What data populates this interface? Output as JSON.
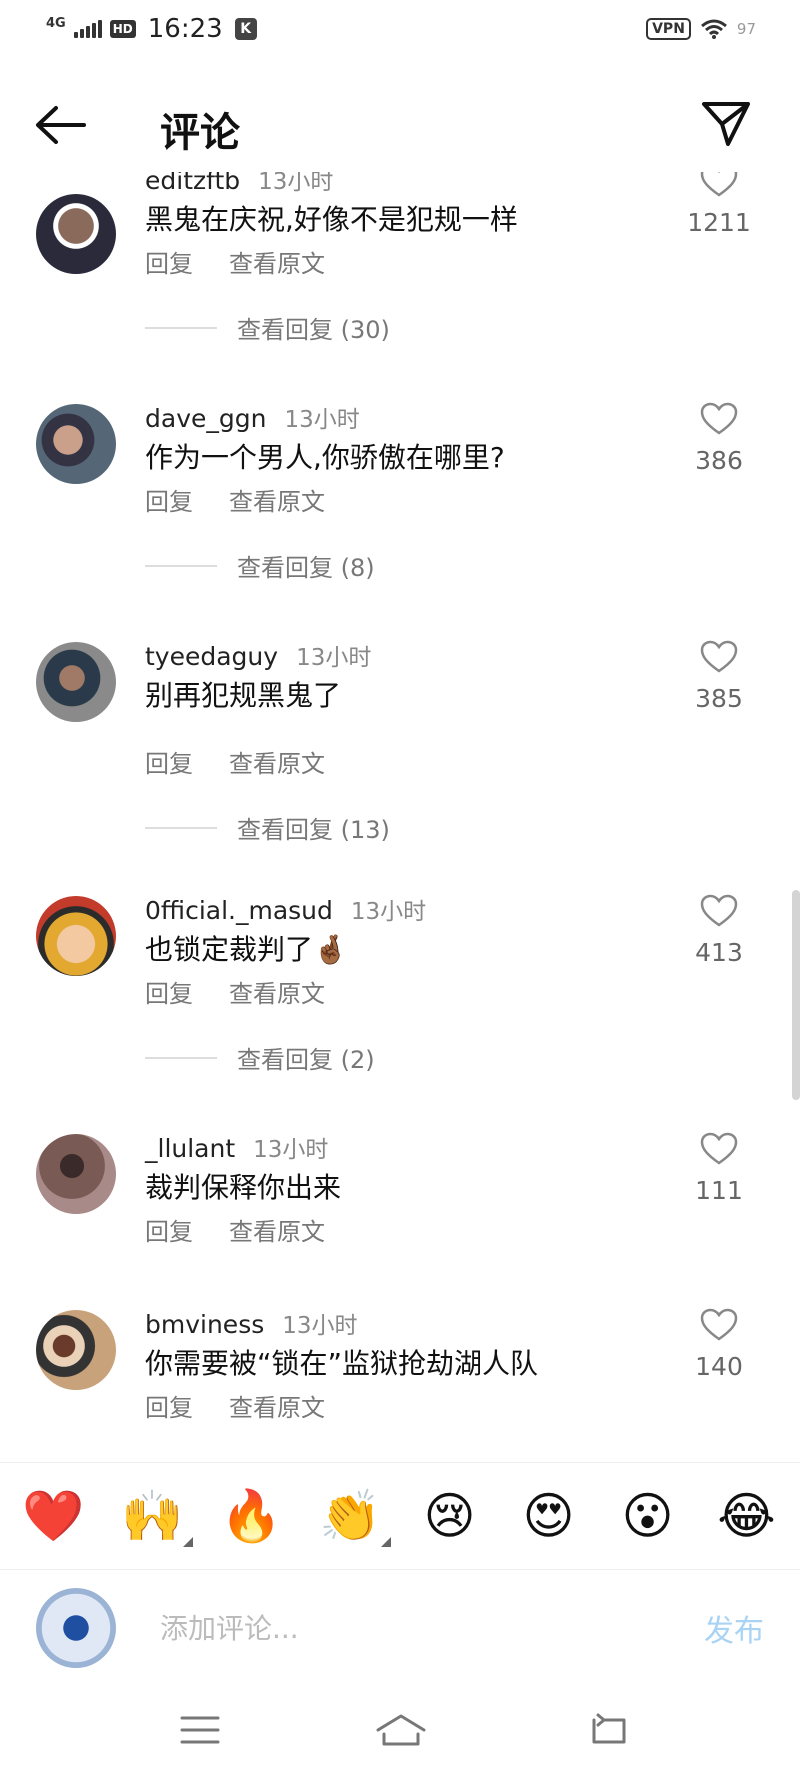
{
  "status_bar": {
    "network": "4G",
    "hd": "HD",
    "time": "16:23",
    "k_badge": "K",
    "vpn": "VPN",
    "battery": "97"
  },
  "header": {
    "title": "评论",
    "back_icon": "arrow-left-icon",
    "share_icon": "paper-plane-icon"
  },
  "comments": [
    {
      "username": "editzftb",
      "time": "13小时",
      "text": "黑鬼在庆祝,好像不是犯规一样",
      "likes": "1211",
      "reply": "回复",
      "view_original": "查看原文",
      "view_replies": "查看回复 (30)"
    },
    {
      "username": "dave_ggn",
      "time": "13小时",
      "text": "作为一个男人,你骄傲在哪里?",
      "likes": "386",
      "reply": "回复",
      "view_original": "查看原文",
      "view_replies": "查看回复 (8)"
    },
    {
      "username": "tyeedaguy",
      "time": "13小时",
      "text": "别再犯规黑鬼了",
      "likes": "385",
      "reply": "回复",
      "view_original": "查看原文",
      "view_replies": "查看回复 (13)"
    },
    {
      "username": "0fficial._masud",
      "time": "13小时",
      "text": "也锁定裁判了🤞🏾",
      "likes": "413",
      "reply": "回复",
      "view_original": "查看原文",
      "view_replies": "查看回复 (2)"
    },
    {
      "username": "_llulant",
      "time": "13小时",
      "text": "裁判保释你出来",
      "likes": "111",
      "reply": "回复",
      "view_original": "查看原文"
    },
    {
      "username": "bmviness",
      "time": "13小时",
      "text": "你需要被“锁在”监狱抢劫湖人队",
      "likes": "140",
      "reply": "回复",
      "view_original": "查看原文"
    }
  ],
  "emoji_bar": [
    "❤️",
    "🙌",
    "🔥",
    "👏",
    "😢",
    "😍",
    "😮",
    "😂"
  ],
  "input": {
    "placeholder": "添加评论...",
    "post_label": "发布"
  },
  "nav": [
    "menu-icon",
    "home-icon",
    "back-icon"
  ],
  "colors": {
    "post_button": "#a9d3f5",
    "secondary_text": "#777777"
  }
}
